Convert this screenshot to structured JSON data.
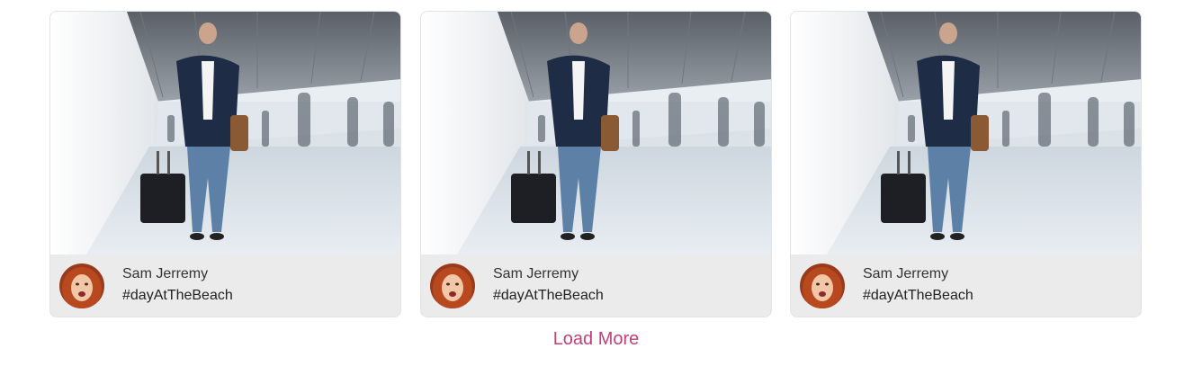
{
  "colors": {
    "accent": "#c2407a",
    "card_footer_bg": "#ebebeb",
    "card_border": "#e3e3e3",
    "text": "#333333"
  },
  "cards": [
    {
      "image": "man-with-suitcase-airport-photo",
      "avatar": "red-haired-woman-avatar",
      "user_name": "Sam Jerremy",
      "hashtag": "#dayAtTheBeach"
    },
    {
      "image": "man-with-suitcase-airport-photo",
      "avatar": "red-haired-woman-avatar",
      "user_name": "Sam Jerremy",
      "hashtag": "#dayAtTheBeach"
    },
    {
      "image": "man-with-suitcase-airport-photo",
      "avatar": "red-haired-woman-avatar",
      "user_name": "Sam Jerremy",
      "hashtag": "#dayAtTheBeach"
    }
  ],
  "load_more_label": "Load More"
}
